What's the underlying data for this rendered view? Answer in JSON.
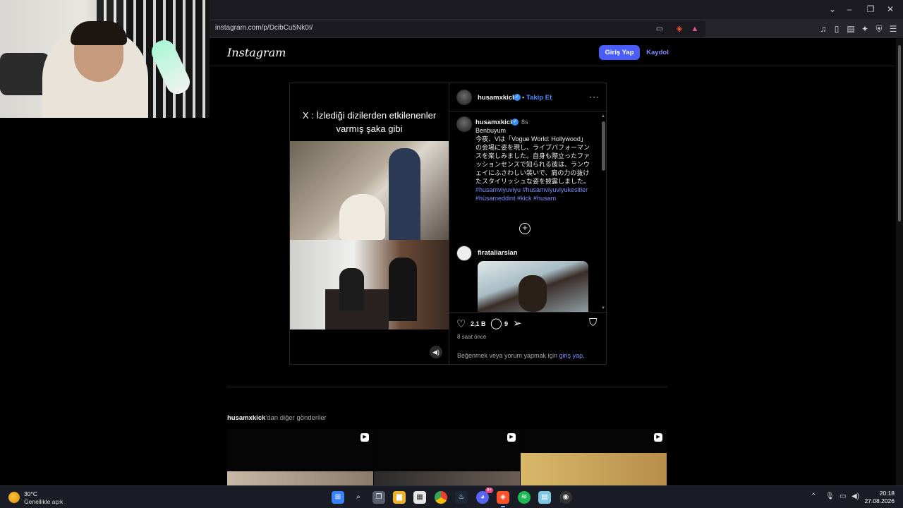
{
  "browser": {
    "url": "instagram.com/p/DcibCu5Nk0I/",
    "window_controls": {
      "collapse": "⌄",
      "minimize": "–",
      "restore": "❐",
      "close": "✕"
    }
  },
  "header": {
    "logo": "Instagram",
    "login_label": "Giriş Yap",
    "signup_label": "Kaydol"
  },
  "post": {
    "video_caption_line1": "X : İzlediği dizilerden etkilenenler",
    "video_caption_line2": "varmış şaka gibi",
    "author": "husamxkick",
    "follow_sep": "•",
    "follow_label": "Takip Et",
    "more_label": "···",
    "caption_time": "8s",
    "caption_first_line": "Benbuyum",
    "caption_body": "今夜、Vは「Vogue World: Hollywood」の会場に姿を現し、ライブパフォーマンスを楽しみました。自身も際立ったファッションセンスで知られる彼は、ランウェイにふさわしい装いで、肩の力の抜けたスタイリッシュな姿を披露しました。",
    "hashtags": "#husamviyuviyu #husamviyuviyukesitler #hüsameddint #kick #husam",
    "comment_user": "firataliarslan",
    "likes": "2,1 B",
    "comments": "9",
    "posted_ago": "8 saat önce",
    "login_prompt": "Beğenmek veya yorum yapmak için",
    "login_link": "giriş yap",
    "login_end": "."
  },
  "more_posts": {
    "author": "husamxkick",
    "suffix": "'dan diğer gönderiler"
  },
  "taskbar": {
    "temperature": "30°C",
    "weather": "Genellikle açık",
    "time": "20:18",
    "date": "27.08.2026",
    "discord_badge": "9+"
  },
  "icons": [
    "heart-icon",
    "comment-icon",
    "share-icon",
    "bookmark-icon",
    "plus-circle-icon",
    "volume-icon",
    "verified-icon",
    "reel-icon"
  ],
  "colors": {
    "accent": "#4a5df9",
    "link": "#7d8cff",
    "verified": "#3b8cf5"
  }
}
